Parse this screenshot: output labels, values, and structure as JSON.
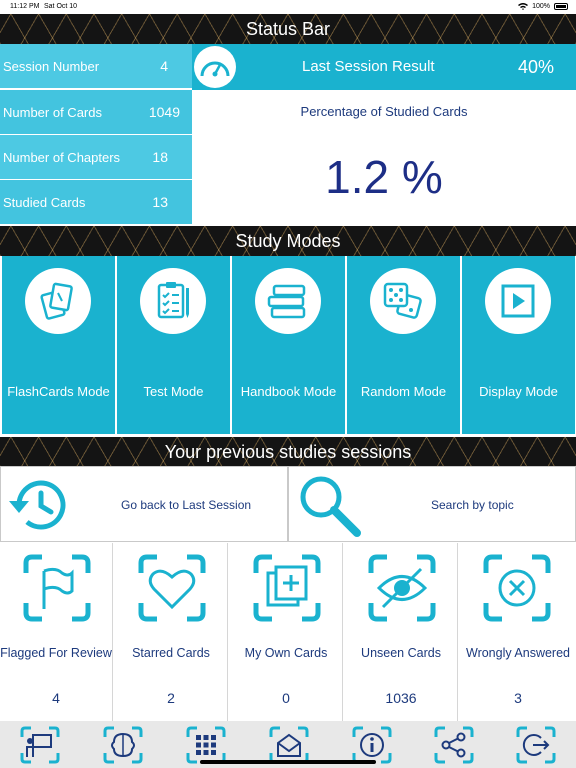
{
  "device_status": {
    "time": "11:12 PM",
    "date": "Sat Oct 10",
    "battery": "100%"
  },
  "status_bar": {
    "title": "Status Bar"
  },
  "stats": [
    {
      "label": "Session Number",
      "value": "4"
    },
    {
      "label": "Number of Cards",
      "value": "1049"
    },
    {
      "label": "Number of Chapters",
      "value": "18"
    },
    {
      "label": "Studied Cards",
      "value": "13"
    }
  ],
  "last_session": {
    "label": "Last Session Result",
    "value": "40%",
    "icon": "speedometer-icon"
  },
  "progress": {
    "caption": "Percentage of Studied Cards",
    "value": "1.2 %"
  },
  "study_modes": {
    "title": "Study Modes",
    "items": [
      {
        "label": "FlashCards Mode",
        "icon": "flashcards-icon"
      },
      {
        "label": "Test Mode",
        "icon": "checklist-icon"
      },
      {
        "label": "Handbook Mode",
        "icon": "books-icon"
      },
      {
        "label": "Random Mode",
        "icon": "dice-icon"
      },
      {
        "label": "Display Mode",
        "icon": "play-icon"
      }
    ]
  },
  "previous": {
    "title": "Your previous studies sessions",
    "back_label": "Go back to Last Session",
    "search_label": "Search by topic"
  },
  "categories": [
    {
      "label": "Flagged For Review",
      "count": "4",
      "icon": "flag-icon"
    },
    {
      "label": "Starred Cards",
      "count": "2",
      "icon": "heart-icon"
    },
    {
      "label": "My Own Cards",
      "count": "0",
      "icon": "add-card-icon"
    },
    {
      "label": "Unseen Cards",
      "count": "1036",
      "icon": "eye-off-icon"
    },
    {
      "label": "Wrongly Answered",
      "count": "3",
      "icon": "x-circle-icon"
    }
  ],
  "toolbar": [
    "presentation-icon",
    "brain-icon",
    "grid-icon",
    "mail-icon",
    "info-icon",
    "share-icon",
    "exit-icon"
  ],
  "colors": {
    "cyan": "#1ab2cf",
    "light_cyan": "#4dc9e3",
    "navy_text": "#1d3a7d"
  }
}
